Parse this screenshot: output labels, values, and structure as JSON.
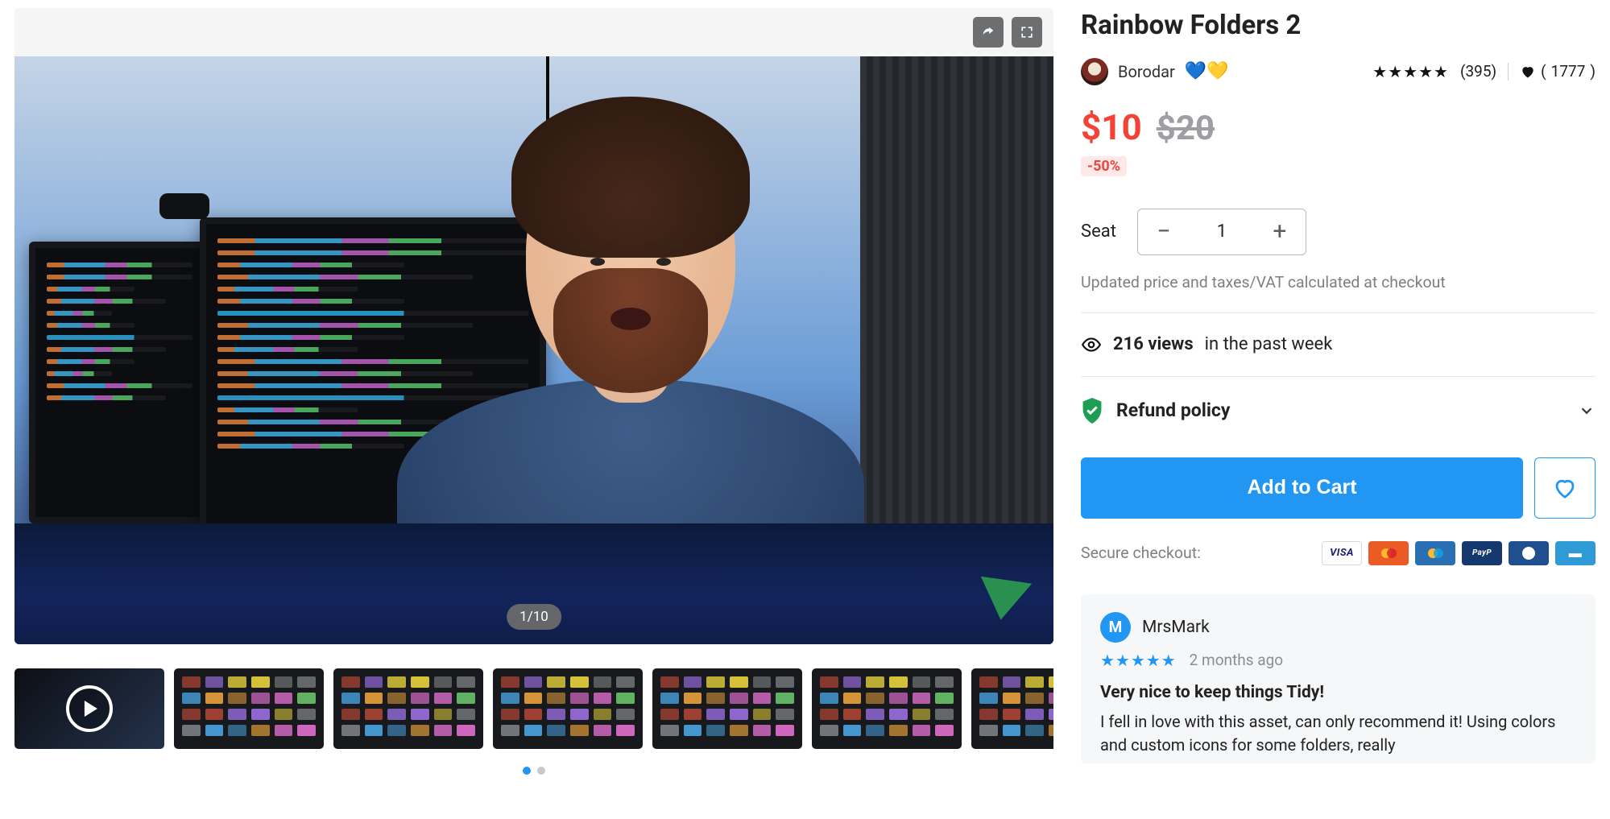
{
  "product": {
    "title": "Rainbow Folders 2",
    "author": {
      "name": "Borodar",
      "flag": "💙💛"
    },
    "rating": {
      "stars": 5,
      "count": 395
    },
    "favorites": 1777,
    "price": {
      "current": "$10",
      "original": "$20",
      "discount": "-50%"
    },
    "seat": {
      "label": "Seat",
      "value": 1
    },
    "tax_note": "Updated price and taxes/VAT calculated at checkout",
    "views": {
      "count": "216 views",
      "suffix": "in the past week"
    },
    "refund_label": "Refund policy",
    "add_to_cart": "Add to Cart",
    "secure_checkout": "Secure checkout:",
    "payment_methods": [
      "visa",
      "mastercard",
      "maestro",
      "paypal",
      "diners",
      "amex"
    ]
  },
  "gallery": {
    "counter": "1/10",
    "thumbnails": [
      {
        "type": "video"
      },
      {
        "type": "image"
      },
      {
        "type": "image"
      },
      {
        "type": "image"
      },
      {
        "type": "image"
      },
      {
        "type": "image"
      },
      {
        "type": "image"
      },
      {
        "type": "image"
      }
    ],
    "pager": {
      "active": 0,
      "total": 2
    }
  },
  "review": {
    "avatar_initial": "M",
    "name": "MrsMark",
    "stars": 5,
    "time": "2 months ago",
    "title": "Very nice to keep things Tidy!",
    "body": "I fell in love with this asset, can only recommend it! Using colors and custom icons for some folders, really"
  }
}
